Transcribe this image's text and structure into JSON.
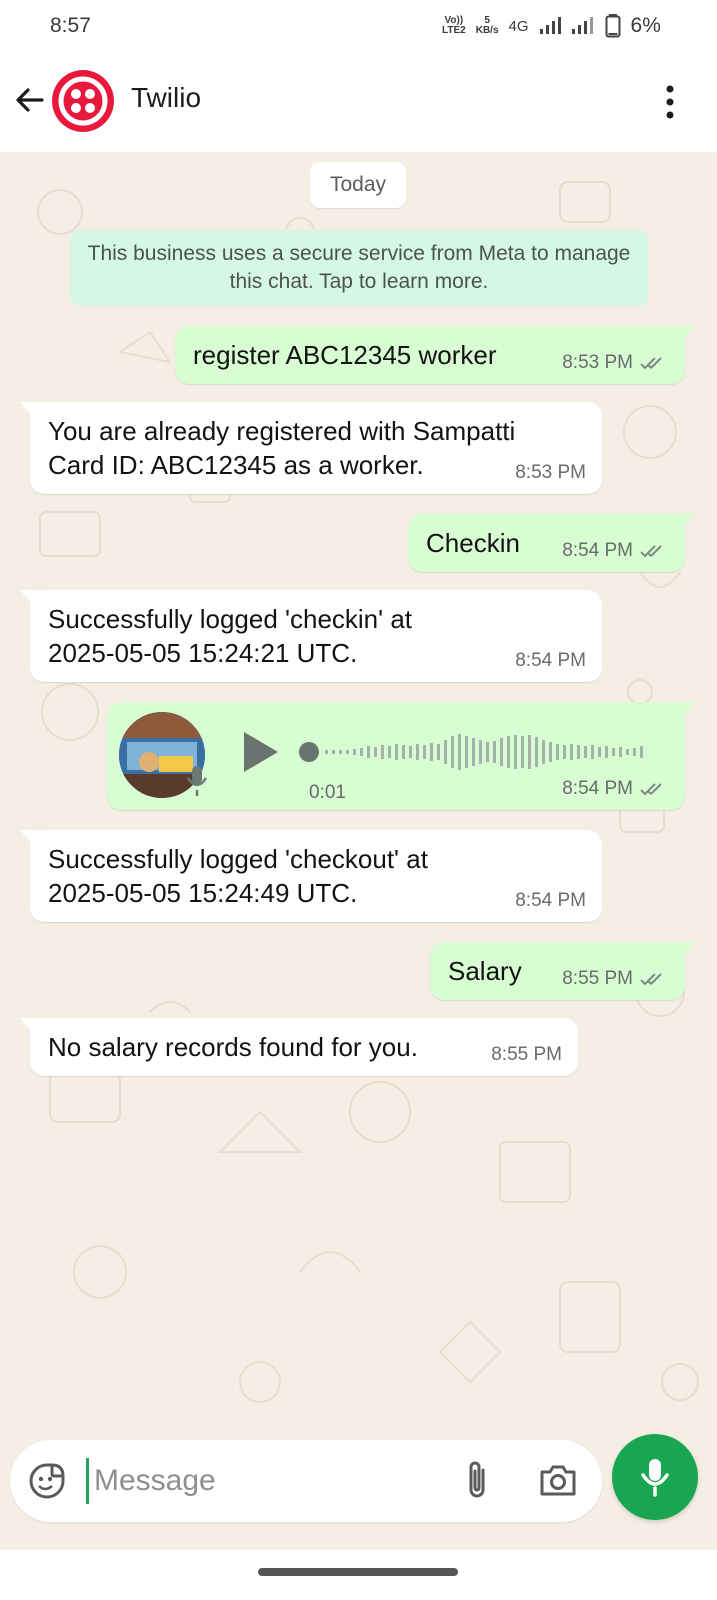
{
  "status_bar": {
    "time": "8:57",
    "volte": "Vo))",
    "lte2": "LTE2",
    "speed": "5",
    "speed_unit": "KB/s",
    "network": "4G",
    "battery": "6%"
  },
  "header": {
    "title": "Twilio",
    "brand_color": "#e8193c"
  },
  "chat": {
    "date_chip": "Today",
    "system_note": "This business uses a secure service from Meta to manage this chat. Tap to learn more.",
    "messages": [
      {
        "direction": "out",
        "text": "register ABC12345 worker",
        "time": "8:53 PM",
        "read": true
      },
      {
        "direction": "in",
        "text": "You are already registered with Sampatti\nCard ID: ABC12345 as a worker.",
        "time": "8:53 PM"
      },
      {
        "direction": "out",
        "text": "Checkin",
        "time": "8:54 PM",
        "read": true
      },
      {
        "direction": "in",
        "text": "Successfully logged 'checkin' at\n2025-05-05 15:24:21 UTC.",
        "time": "8:54 PM"
      },
      {
        "direction": "out",
        "type": "voice",
        "duration": "0:01",
        "time": "8:54 PM",
        "read": true
      },
      {
        "direction": "in",
        "text": "Successfully logged 'checkout' at\n2025-05-05 15:24:49 UTC.",
        "time": "8:54 PM"
      },
      {
        "direction": "out",
        "text": "Salary",
        "time": "8:55 PM",
        "read": true
      },
      {
        "direction": "in",
        "text": "No salary records found for you.",
        "time": "8:55 PM"
      }
    ]
  },
  "composer": {
    "placeholder": "Message",
    "icons": [
      "sticker-icon",
      "paperclip-icon",
      "camera-icon",
      "mic-icon"
    ]
  },
  "colors": {
    "outgoing": "#d8fdd2",
    "incoming": "#ffffff",
    "accent": "#1aa552",
    "system_note": "#d6f7e6"
  }
}
